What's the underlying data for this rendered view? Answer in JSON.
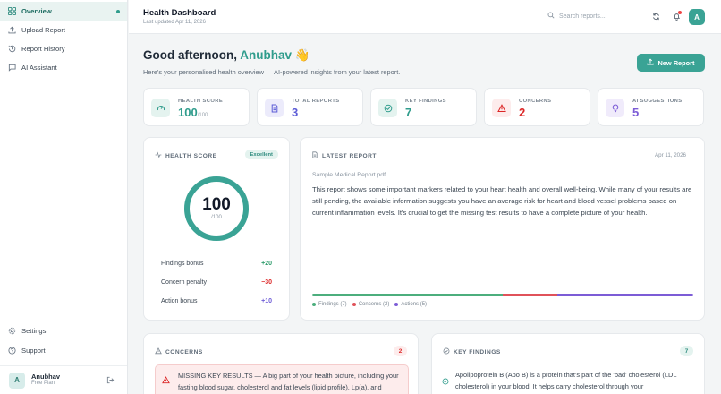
{
  "sidebar": {
    "items": [
      {
        "label": "Overview",
        "icon": "grid-icon",
        "active": true
      },
      {
        "label": "Upload Report",
        "icon": "upload-icon"
      },
      {
        "label": "Report History",
        "icon": "history-icon"
      },
      {
        "label": "AI Assistant",
        "icon": "chat-icon"
      }
    ],
    "bottom": [
      {
        "label": "Settings",
        "icon": "gear-icon"
      },
      {
        "label": "Support",
        "icon": "help-icon"
      }
    ],
    "user": {
      "initial": "A",
      "name": "Anubhav",
      "plan": "Free Plan"
    }
  },
  "header": {
    "title": "Health Dashboard",
    "subtitle": "Last updated Apr 11, 2026",
    "search_placeholder": "Search reports...",
    "avatar_initial": "A"
  },
  "greeting": {
    "prefix": "Good afternoon, ",
    "name": "Anubhav",
    "emoji": "👋",
    "subtitle": "Here's your personalised health overview — AI-powered insights from your latest report.",
    "button": "New Report"
  },
  "stats": [
    {
      "label": "HEALTH SCORE",
      "value": "100",
      "suffix": "/100",
      "color": "#2f9c8c",
      "bg": "#e4f3ef"
    },
    {
      "label": "TOTAL REPORTS",
      "value": "3",
      "suffix": "",
      "color": "#5b5bd6",
      "bg": "#ecebfb"
    },
    {
      "label": "KEY FINDINGS",
      "value": "7",
      "suffix": "",
      "color": "#2f9c8c",
      "bg": "#e4f3ef"
    },
    {
      "label": "CONCERNS",
      "value": "2",
      "suffix": "",
      "color": "#dc2626",
      "bg": "#fdecec"
    },
    {
      "label": "AI SUGGESTIONS",
      "value": "5",
      "suffix": "",
      "color": "#7c5cd6",
      "bg": "#f0ebfb"
    }
  ],
  "health_card": {
    "title": "HEALTH SCORE",
    "badge": "Excellent",
    "score": "100",
    "denominator": "/100",
    "score_fraction": 1.0,
    "rows": [
      {
        "label": "Findings bonus",
        "value": "+20",
        "color": "#2f9c6c"
      },
      {
        "label": "Concern penalty",
        "value": "−30",
        "color": "#dc2626"
      },
      {
        "label": "Action bonus",
        "value": "+10",
        "color": "#6d5bd6"
      }
    ]
  },
  "latest_report": {
    "title": "LATEST REPORT",
    "date": "Apr 11, 2026",
    "file": "Sample Medical Report.pdf",
    "summary": "This report shows some important markers related to your heart health and overall well-being. While many of your results are still pending, the available information suggests you have an average risk for heart and blood vessel problems based on current inflammation levels. It's crucial to get the missing test results to have a complete picture of your health.",
    "distribution": [
      {
        "label": "Findings (7)",
        "count": 7,
        "color": "#4cae7d"
      },
      {
        "label": "Concerns (2)",
        "count": 2,
        "color": "#e0525a"
      },
      {
        "label": "Actions (5)",
        "count": 5,
        "color": "#7c5cd6"
      }
    ]
  },
  "concerns": {
    "title": "CONCERNS",
    "count": "2",
    "first": "MISSING KEY RESULTS — A big part of your health picture, including your fasting blood sugar, cholesterol and fat levels (lipid profile), Lp(a), and"
  },
  "findings": {
    "title": "KEY FINDINGS",
    "count": "7",
    "first": "Apolipoprotein B (Apo B) is a protein that's part of the 'bad' cholesterol (LDL cholesterol) in your blood. It helps carry cholesterol through your"
  }
}
